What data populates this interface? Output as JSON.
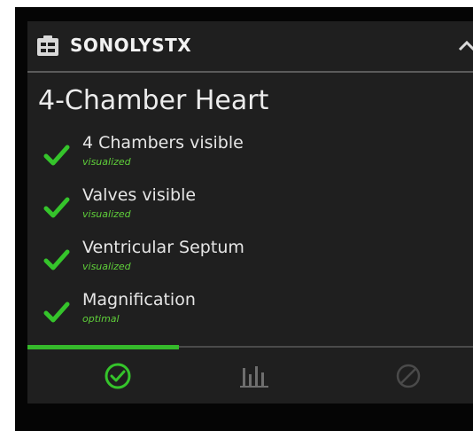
{
  "panel": {
    "app_name": "SONOLYSTX",
    "app_icon": "checklist-icon",
    "collapse_icon": "chevron-up-icon",
    "view_title": "4-Chamber Heart"
  },
  "checks": [
    {
      "label": "4 Chambers visible",
      "status": "visualized",
      "icon": "checkmark-icon"
    },
    {
      "label": "Valves visible",
      "status": "visualized",
      "icon": "checkmark-icon"
    },
    {
      "label": "Ventricular Septum",
      "status": "visualized",
      "icon": "checkmark-icon"
    },
    {
      "label": "Magnification",
      "status": "optimal",
      "icon": "checkmark-icon"
    }
  ],
  "tabs": [
    {
      "icon": "check-circle-icon",
      "active": true
    },
    {
      "icon": "bar-chart-icon",
      "active": false
    },
    {
      "icon": "disabled-circle-icon",
      "active": false
    }
  ],
  "colors": {
    "accent": "#35b92b",
    "status_text": "#5fcf3a",
    "panel_background": "#1f1f1f",
    "screen_background": "#050505"
  },
  "active_tab_fraction": 0.34
}
